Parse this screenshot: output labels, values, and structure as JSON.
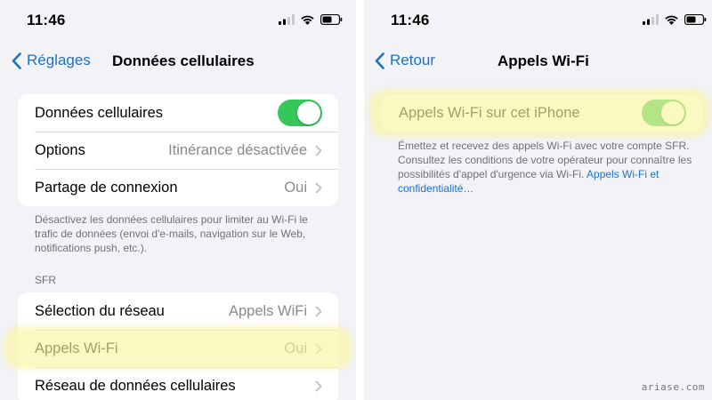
{
  "left": {
    "status": {
      "time": "11:46"
    },
    "nav": {
      "back_label": "Réglages",
      "title": "Données cellulaires"
    },
    "group1": {
      "cellular_data": {
        "label": "Données cellulaires",
        "toggle_on": true
      },
      "options": {
        "label": "Options",
        "value": "Itinérance désactivée"
      },
      "hotspot": {
        "label": "Partage de connexion",
        "value": "Oui"
      }
    },
    "footnote": "Désactivez les données cellulaires pour limiter au Wi-Fi le trafic de données (envoi d'e-mails, navigation sur le Web, notifications push, etc.).",
    "section_header": "SFR",
    "group2": {
      "network_selection": {
        "label": "Sélection du réseau",
        "value": "Appels WiFi"
      },
      "wifi_calling": {
        "label": "Appels Wi-Fi",
        "value": "Oui"
      },
      "cellular_network": {
        "label": "Réseau de données cellulaires"
      }
    }
  },
  "right": {
    "status": {
      "time": "11:46"
    },
    "nav": {
      "back_label": "Retour",
      "title": "Appels Wi-Fi"
    },
    "wifi_calling_toggle": {
      "label": "Appels Wi-Fi sur cet iPhone",
      "toggle_on": true
    },
    "footnote": "Émettez et recevez des appels Wi-Fi avec votre compte SFR. Consultez les conditions de votre opérateur pour connaître les possibilités d'appel d'urgence via Wi-Fi.",
    "footnote_link": "Appels Wi-Fi et confidentialité…"
  },
  "watermark": "ariase.com",
  "colors": {
    "accent": "#1a73c8",
    "toggle_on": "#34c759",
    "highlight": "#faf5a0",
    "background": "#f2f2f7"
  }
}
